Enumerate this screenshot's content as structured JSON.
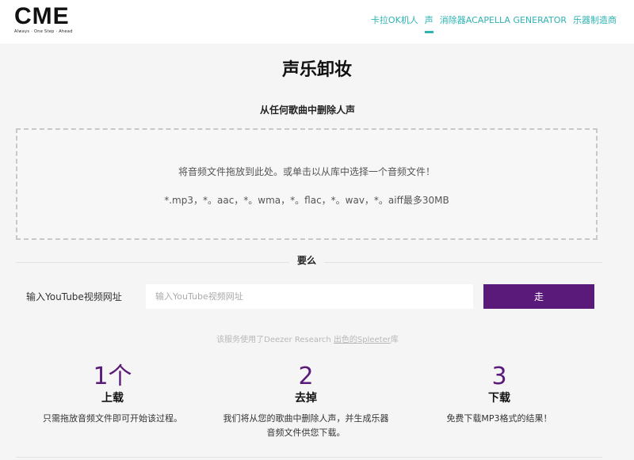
{
  "header": {
    "logo_text": "CME",
    "logo_tagline": "Always · One Step · Ahead",
    "nav": [
      {
        "label": "卡拉OK机人"
      },
      {
        "label": "声"
      },
      {
        "label": "消除器ACAPELLA GENERATOR"
      },
      {
        "label": "乐器制造商"
      }
    ],
    "accent_color": "#2fb3b3"
  },
  "main": {
    "title": "声乐卸妆",
    "subtitle": "从任何歌曲中删除人声",
    "dropzone": {
      "line1": "将音频文件拖放到此处。或单击以从库中选择一个音频文件！",
      "line2": "*.mp3，*。aac，*。wma，*。flac，*。wav，*。aiff最多30MB"
    },
    "or_label": "要么",
    "youtube": {
      "label": "输入YouTube视频网址",
      "placeholder": "输入YouTube视频网址",
      "value": "",
      "button_label": "走"
    },
    "credit": {
      "prefix": "该服务使用了Deezer Research ",
      "link1": "出色的",
      "link2": "Spleeter",
      "suffix": "库"
    },
    "steps": [
      {
        "number": "1个",
        "title": "上载",
        "desc": "只需拖放音频文件即可开始该过程。"
      },
      {
        "number": "2",
        "title": "去掉",
        "desc": "我们将从您的歌曲中删除人声，并生成乐器音频文件供您下载。"
      },
      {
        "number": "3",
        "title": "下载",
        "desc": "免费下载MP3格式的结果！"
      }
    ],
    "brand_color": "#5a1a7a"
  }
}
